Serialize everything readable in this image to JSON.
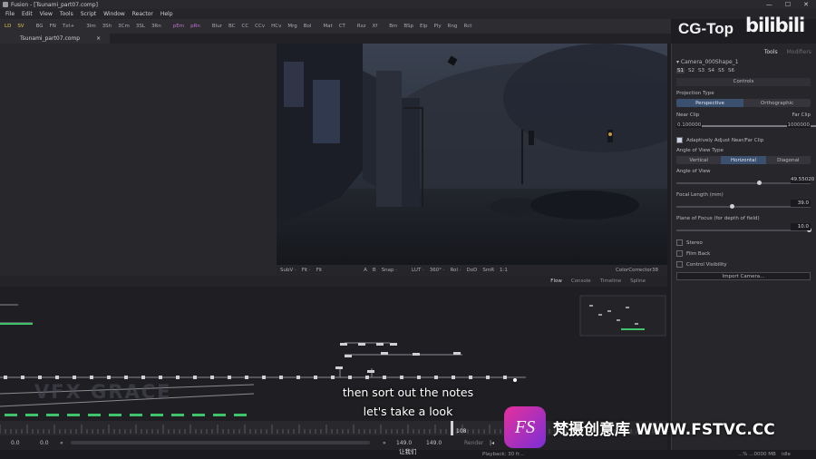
{
  "window": {
    "title": "Fusion - [Tsunami_part07.comp]",
    "controls": [
      "—",
      "☐",
      "✕"
    ]
  },
  "menu": [
    "File",
    "Edit",
    "View",
    "Tools",
    "Script",
    "Window",
    "Reactor",
    "Help"
  ],
  "toolbar": [
    "LD",
    "SV",
    "BG",
    "FN",
    "Txt+",
    "3Im",
    "3Sh",
    "3Cm",
    "3SL",
    "3Rn",
    "pEm",
    "pRn",
    "Blur",
    "BC",
    "CC",
    "CCv",
    "HCv",
    "Mrg",
    "Bol",
    "Mat",
    "CT",
    "Rsz",
    "Xf",
    "Bm",
    "BSp",
    "Elp",
    "Ply",
    "Rng",
    "Rct"
  ],
  "tab": {
    "label": "Tsunami_part07.comp",
    "close": "×"
  },
  "viewer_toolbar": {
    "left": [
      "SubV ·",
      "Fit ·",
      "Fit"
    ],
    "mid": [
      "A",
      "B",
      "Snap ·",
      "LUT ·",
      "360° ·",
      "RoI ·",
      "DoD",
      "SmR",
      "1:1"
    ],
    "right": "ColorCorrector38"
  },
  "flow_tabs": [
    "Flow",
    "Console",
    "Timeline",
    "Spline"
  ],
  "inspector": {
    "tabs": [
      "Tools",
      "Modifiers"
    ],
    "node_name": "Camera_000Shape_1",
    "sub_tabs": [
      "S1",
      "S2",
      "S3",
      "S4",
      "S5",
      "S6"
    ],
    "controls_header": "Controls",
    "projection_label": "Projection Type",
    "projection_options": [
      "Perspective",
      "Orthographic"
    ],
    "near_clip_label": "Near Clip",
    "far_clip_label": "Far Clip",
    "near_clip_value": "0.100000",
    "far_clip_value": "1000000",
    "adaptive_label": "Adaptively Adjust Near/Far Clip",
    "aov_type_label": "Angle of View Type",
    "aov_type_options": [
      "Vertical",
      "Horizontal",
      "Diagonal"
    ],
    "aov_label": "Angle of View",
    "aov_value": "49.55020",
    "focal_label": "Focal Length (mm)",
    "focal_value": "39.0",
    "focus_label": "Plane of Focus (for depth of field)",
    "focus_value": "10.0",
    "stereo_label": "Stereo",
    "filmback_label": "Film Back",
    "control_vis_label": "Control Visibility",
    "import_button": "Import Camera..."
  },
  "transport": {
    "start": "0.0",
    "current": "0.0",
    "end1": "149.0",
    "end2": "149.0",
    "render": "Render",
    "frame_marker": "108"
  },
  "status": {
    "playback": "Playback: 30 fr...",
    "idle": "idle",
    "memory": "...% ...0000 MB"
  },
  "subtitle": {
    "line1": "then sort out the notes",
    "line2": "let's take a look",
    "cn": "让我们"
  },
  "watermarks": {
    "cg": "CG-Top",
    "bili": "bilibili",
    "fs_badge": "FS",
    "fs_text": "梵摄创意库 WWW.FSTVC.CC",
    "vfx": "VFX GRACE"
  },
  "colors": {
    "accent": "#3b4f6e",
    "node_green": "#3fc46b",
    "fs_pink": "#e6309b"
  }
}
